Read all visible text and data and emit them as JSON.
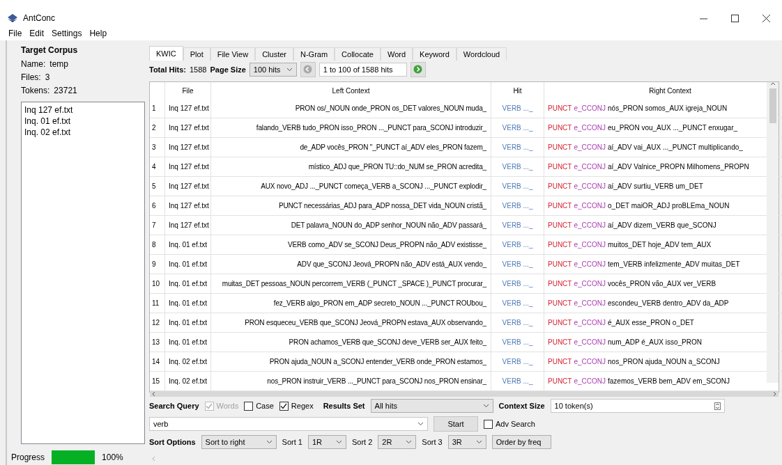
{
  "window": {
    "title": "AntConc"
  },
  "menu": [
    "File",
    "Edit",
    "Settings",
    "Help"
  ],
  "corpus": {
    "heading": "Target Corpus",
    "fields": [
      {
        "label": "Name:",
        "value": "temp"
      },
      {
        "label": "Files:",
        "value": "3"
      },
      {
        "label": "Tokens:",
        "value": "23721"
      }
    ],
    "files": [
      "Inq 127 ef.txt",
      "Inq. 01 ef.txt",
      "Inq. 02 ef.txt"
    ],
    "progress": {
      "label": "Progress",
      "level": 1,
      "reading": "100%"
    }
  },
  "tabs": [
    {
      "label": "KWIC",
      "selected": true
    },
    {
      "label": "Plot",
      "selected": false
    },
    {
      "label": "File View",
      "selected": false
    },
    {
      "label": "Cluster",
      "selected": false
    },
    {
      "label": "N-Gram",
      "selected": false
    },
    {
      "label": "Collocate",
      "selected": false
    },
    {
      "label": "Word",
      "selected": false
    },
    {
      "label": "Keyword",
      "selected": false
    },
    {
      "label": "Wordcloud",
      "selected": false
    }
  ],
  "toolbar": {
    "total_hits_label": "Total Hits:",
    "total_hits": "1588",
    "page_size_label": "Page Size",
    "page_size": "100 hits",
    "range": "1 to 100 of 1588 hits"
  },
  "table": {
    "columns": [
      "File",
      "Left Context",
      "Hit",
      "Right Context"
    ],
    "rows": [
      {
        "n": "1",
        "file": "Inq 127 ef.txt",
        "left": "PRON os/_NOUN onde_PRON os_DET valores_NOUN muda_",
        "hit": "VERB ..._",
        "punct": "PUNCT",
        "conj": "e_CCONJ",
        "right": "nós_PRON somos_AUX igreja_NOUN"
      },
      {
        "n": "2",
        "file": "Inq 127 ef.txt",
        "left": "falando_VERB tudo_PRON isso_PRON ..._PUNCT para_SCONJ introduzir_",
        "hit": "VERB ..._",
        "punct": "PUNCT",
        "conj": "e_CCONJ",
        "right": "eu_PRON vou_AUX ..._PUNCT enxugar_"
      },
      {
        "n": "3",
        "file": "Inq 127 ef.txt",
        "left": "de_ADP vocês_PRON \"_PUNCT aí_ADV eles_PRON fazem_",
        "hit": "VERB ..._",
        "punct": "PUNCT",
        "conj": "e_CCONJ",
        "right": "aí_ADV vai_AUX ..._PUNCT multiplicando_"
      },
      {
        "n": "4",
        "file": "Inq 127 ef.txt",
        "left": "místico_ADJ que_PRON TU::do_NUM se_PRON acredita_",
        "hit": "VERB ..._",
        "punct": "PUNCT",
        "conj": "e_CCONJ",
        "right": "aí_ADV Valnice_PROPN Milhomens_PROPN"
      },
      {
        "n": "5",
        "file": "Inq 127 ef.txt",
        "left": "AUX novo_ADJ ..._PUNCT começa_VERB a_SCONJ ..._PUNCT explodir_",
        "hit": "VERB ..._",
        "punct": "PUNCT",
        "conj": "e_CCONJ",
        "right": "aí_ADV surtiu_VERB um_DET"
      },
      {
        "n": "6",
        "file": "Inq 127 ef.txt",
        "left": "PUNCT necessárias_ADJ para_ADP nossa_DET vida_NOUN cristã_",
        "hit": "VERB ..._",
        "punct": "PUNCT",
        "conj": "e_CCONJ",
        "right": "o_DET maiOR_ADJ proBLEma_NOUN"
      },
      {
        "n": "7",
        "file": "Inq 127 ef.txt",
        "left": "DET palavra_NOUN do_ADP senhor_NOUN não_ADV passará_",
        "hit": "VERB ..._",
        "punct": "PUNCT",
        "conj": "e_CCONJ",
        "right": "aí_ADV dizem_VERB que_SCONJ"
      },
      {
        "n": "8",
        "file": "Inq. 01 ef.txt",
        "left": "VERB como_ADV se_SCONJ Deus_PROPN não_ADV existisse_",
        "hit": "VERB ..._",
        "punct": "PUNCT",
        "conj": "e_CCONJ",
        "right": "muitos_DET hoje_ADV tem_AUX"
      },
      {
        "n": "9",
        "file": "Inq. 01 ef.txt",
        "left": "ADV que_SCONJ Jeová_PROPN não_ADV está_AUX vendo_",
        "hit": "VERB ..._",
        "punct": "PUNCT",
        "conj": "e_CCONJ",
        "right": "tem_VERB infelizmente_ADV muitas_DET"
      },
      {
        "n": "10",
        "file": "Inq. 01 ef.txt",
        "left": "muitas_DET pessoas_NOUN percorrem_VERB (_PUNCT _SPACE )_PUNCT procurar_",
        "hit": "VERB ..._",
        "punct": "PUNCT",
        "conj": "e_CCONJ",
        "right": "vocês_PRON vão_AUX ver_VERB"
      },
      {
        "n": "11",
        "file": "Inq. 01 ef.txt",
        "left": "fez_VERB algo_PRON em_ADP secreto_NOUN ..._PUNCT ROUbou_",
        "hit": "VERB ..._",
        "punct": "PUNCT",
        "conj": "e_CCONJ",
        "right": "escondeu_VERB dentro_ADV da_ADP"
      },
      {
        "n": "12",
        "file": "Inq. 01 ef.txt",
        "left": "PRON esqueceu_VERB que_SCONJ Jeová_PROPN estava_AUX observando_",
        "hit": "VERB ..._",
        "punct": "PUNCT",
        "conj": "e_CCONJ",
        "right": "é_AUX esse_PRON o_DET"
      },
      {
        "n": "13",
        "file": "Inq. 01 ef.txt",
        "left": "PRON achamos_VERB que_SCONJ deve_VERB ser_AUX feito_",
        "hit": "VERB ..._",
        "punct": "PUNCT",
        "conj": "e_CCONJ",
        "right": "num_ADP é_AUX isso_PRON"
      },
      {
        "n": "14",
        "file": "Inq. 02 ef.txt",
        "left": "PRON ajuda_NOUN a_SCONJ entender_VERB onde_PRON estamos_",
        "hit": "VERB ..._",
        "punct": "PUNCT",
        "conj": "e_CCONJ",
        "right": "nos_PRON ajuda_NOUN a_SCONJ"
      },
      {
        "n": "15",
        "file": "Inq. 02 ef.txt",
        "left": "nos_PRON instruir_VERB ..._PUNCT para_SCONJ nos_PRON ensinar_",
        "hit": "VERB ..._",
        "punct": "PUNCT",
        "conj": "e_CCONJ",
        "right": "fazemos_VERB bem_ADV em_SCONJ"
      }
    ]
  },
  "search": {
    "label": "Search Query",
    "options": [
      {
        "label": "Words",
        "checked": true,
        "disabled": true
      },
      {
        "label": "Case",
        "checked": false,
        "disabled": false
      },
      {
        "label": "Regex",
        "checked": true,
        "disabled": false
      }
    ],
    "results_set_label": "Results Set",
    "results_set": "All hits",
    "context_size_label": "Context Size",
    "context_size": "10 token(s)",
    "query": "verb",
    "start": "Start",
    "adv_search": {
      "label": "Adv Search",
      "checked": false
    }
  },
  "sort": {
    "label": "Sort Options",
    "mode": "Sort to right",
    "levels": [
      {
        "label": "Sort 1",
        "value": "1R"
      },
      {
        "label": "Sort 2",
        "value": "2R"
      },
      {
        "label": "Sort 3",
        "value": "3R"
      }
    ],
    "order": "Order by freq"
  }
}
